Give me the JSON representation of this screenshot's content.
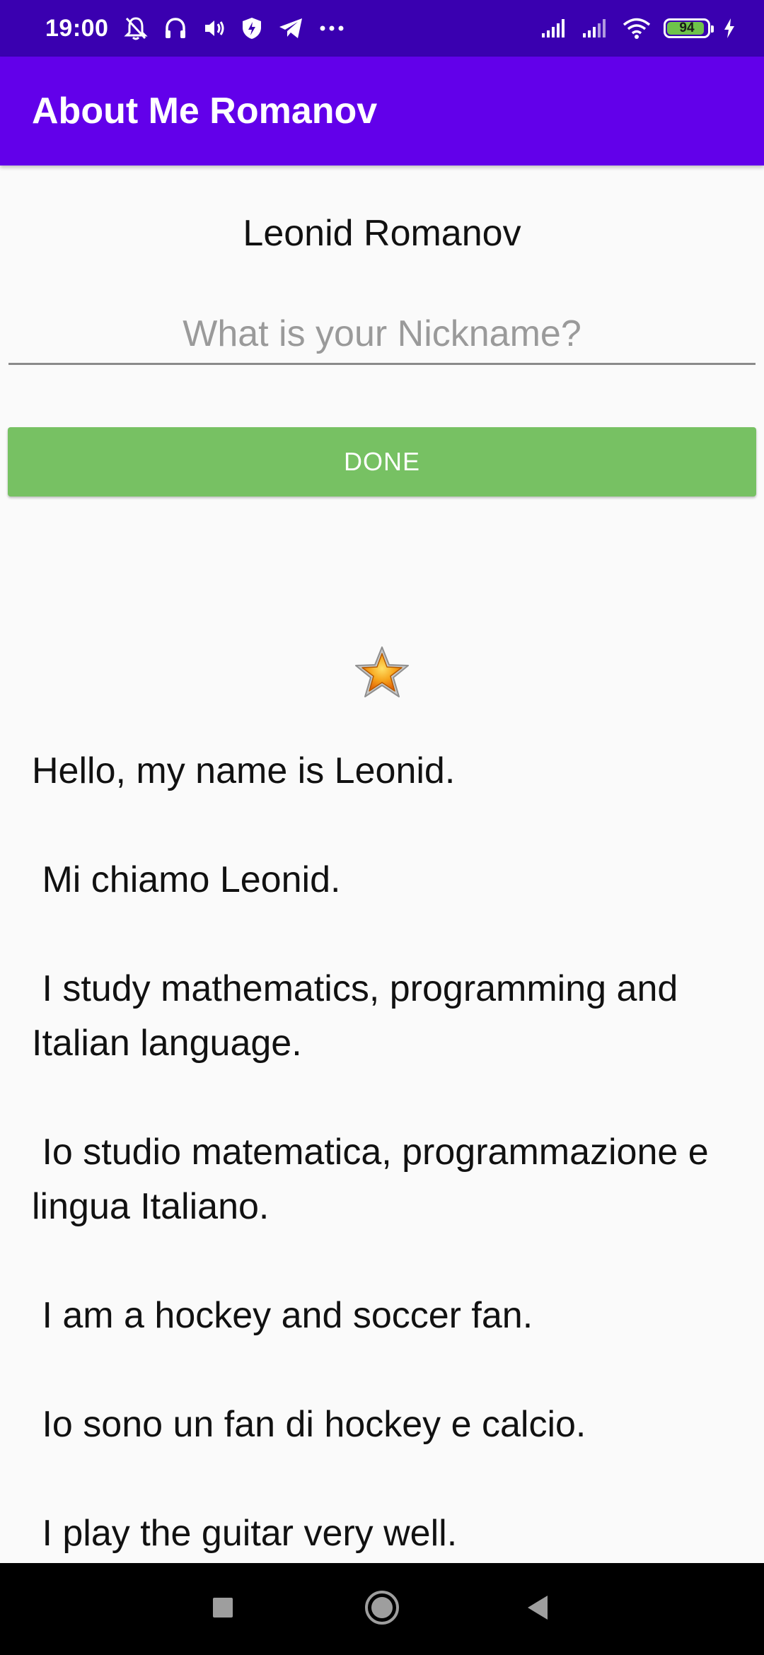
{
  "status_bar": {
    "time": "19:00",
    "battery_level": "94",
    "battery_fraction": 0.94,
    "colors": {
      "background": "#3a00b0",
      "battery_fill": "#6ec34a"
    },
    "left_icons": [
      "bell-off-icon",
      "headphones-icon",
      "volume-icon",
      "shield-icon",
      "telegram-icon",
      "more-icon"
    ],
    "right_icons": [
      "signal-icon",
      "signal-icon",
      "wifi-icon",
      "battery-icon",
      "charging-icon"
    ]
  },
  "app_bar": {
    "title": "About Me Romanov",
    "color": "#6200ea"
  },
  "profile": {
    "name": "Leonid Romanov",
    "nickname_placeholder": "What is your Nickname?",
    "nickname_value": "",
    "done_label": "DONE",
    "done_color": "#77c163",
    "star_icon": "star-icon"
  },
  "bio": {
    "text": "Hello, my name is Leonid.\n\n Mi chiamo Leonid.\n\n I study mathematics, programming and Italian language.\n\n Io studio matematica, programmazione e lingua Italiano.\n\n I am a hockey and soccer fan.\n\n Io sono un fan di hockey e calcio.\n\n I play the guitar very well."
  },
  "nav_bar": {
    "buttons": [
      "recents-square-icon",
      "home-circle-icon",
      "back-triangle-icon"
    ]
  }
}
